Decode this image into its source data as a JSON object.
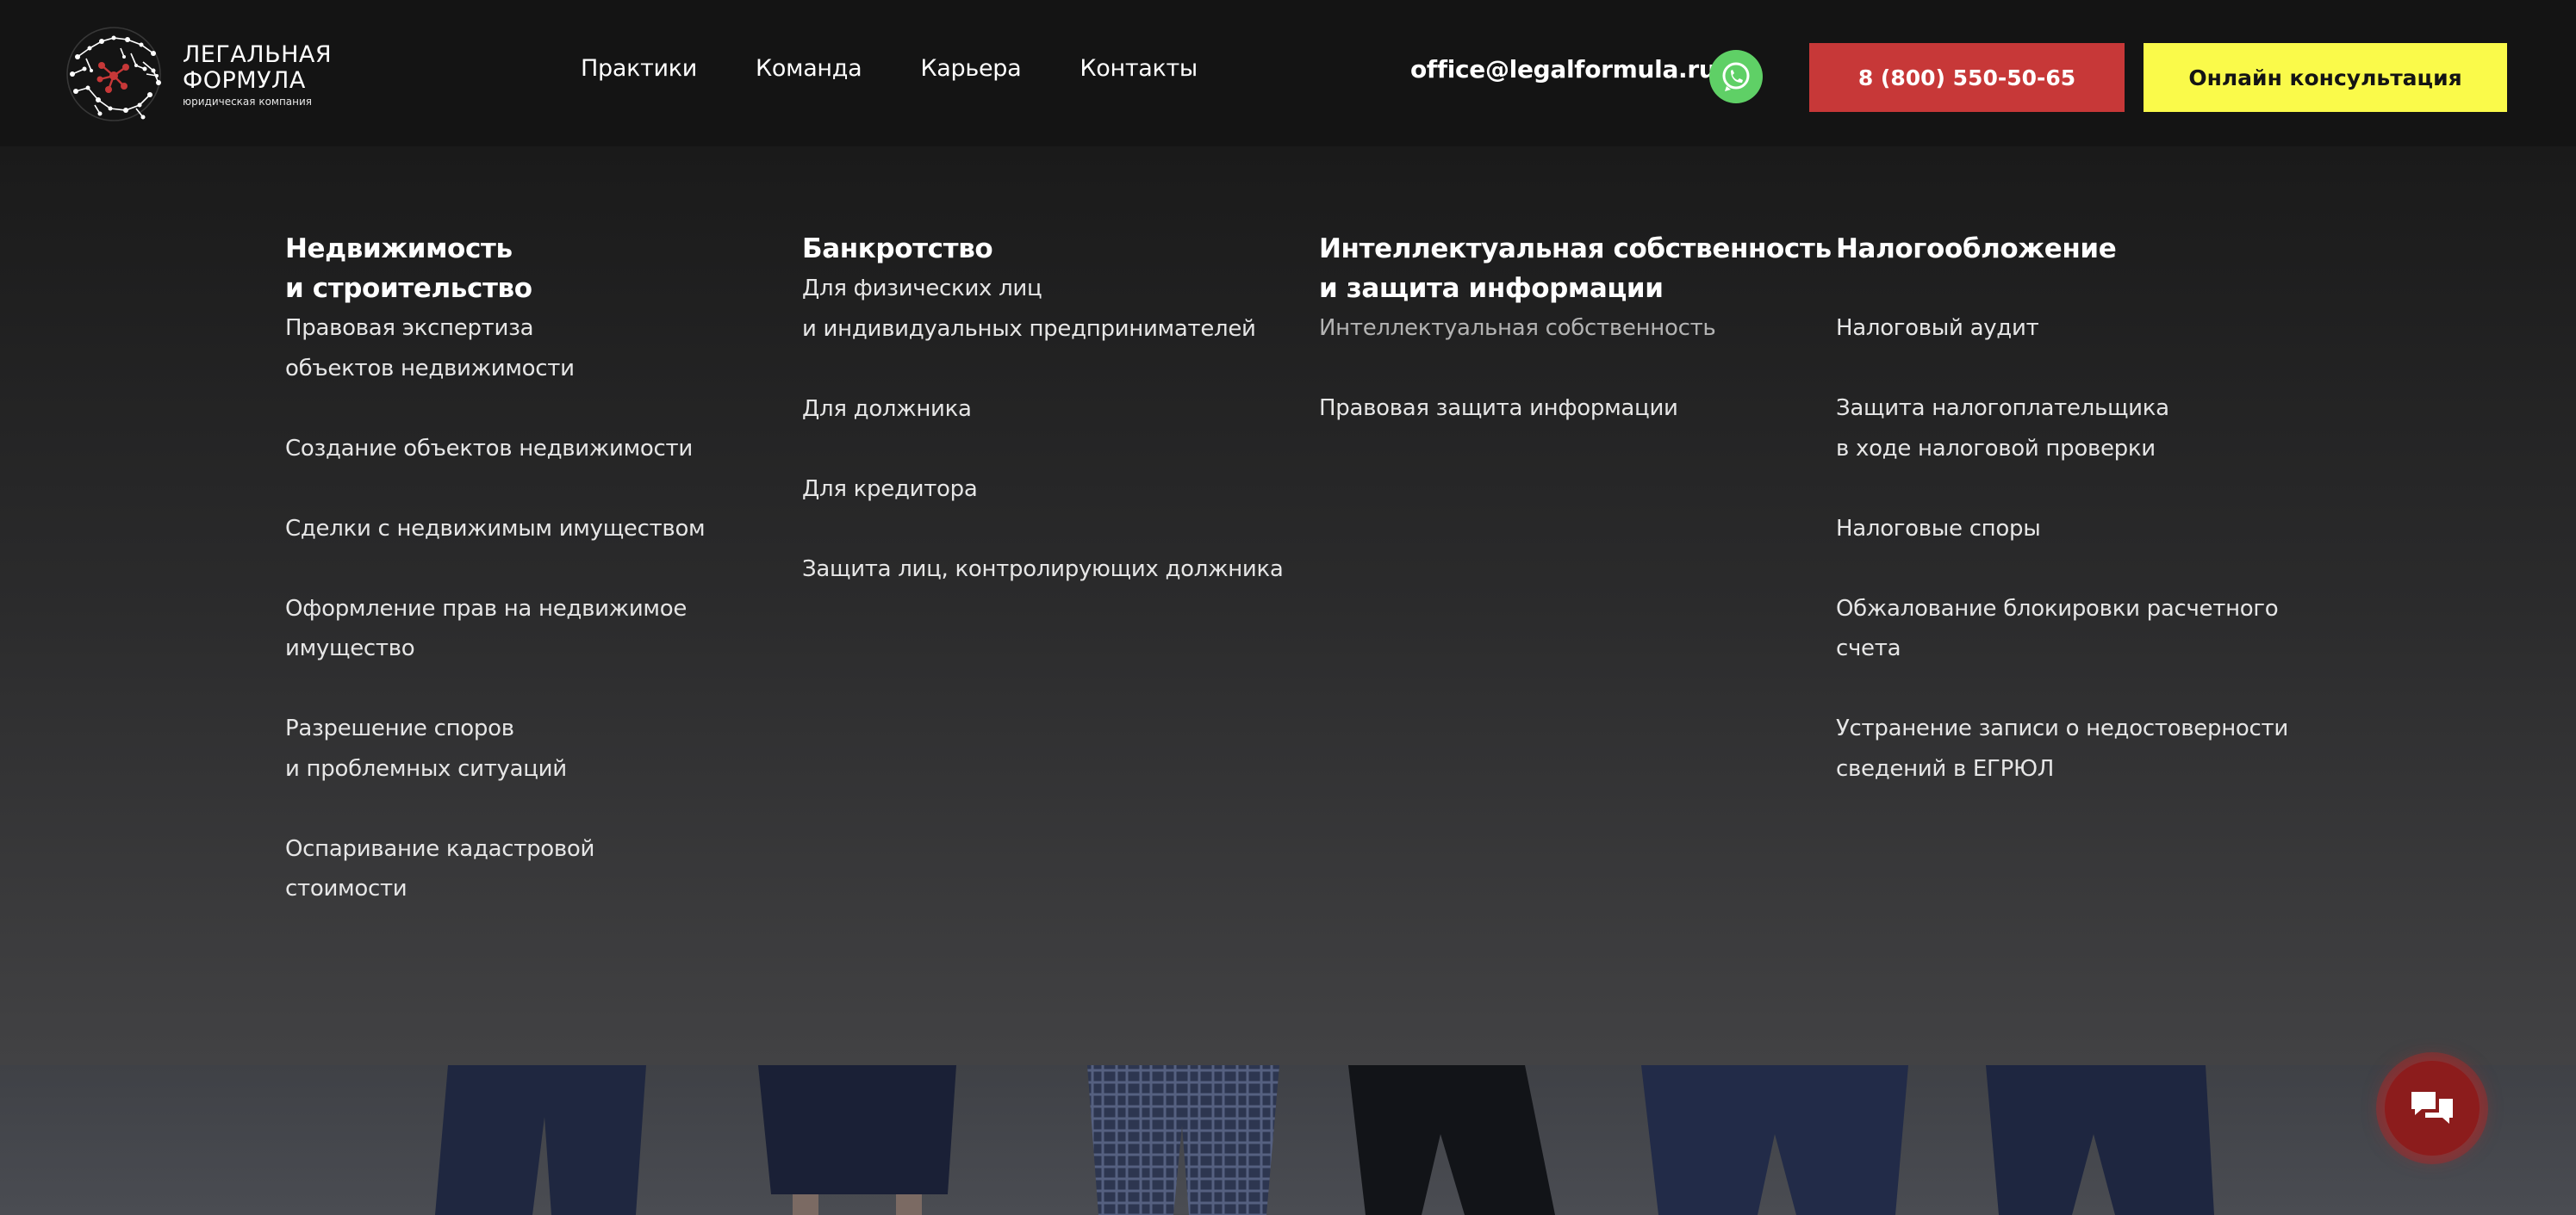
{
  "logo": {
    "line1": "ЛЕГАЛЬНАЯ",
    "line2": "ФОРМУЛА",
    "subtitle": "юридическая компания",
    "accent": "#c73838"
  },
  "nav": {
    "items": [
      "Практики",
      "Команда",
      "Карьера",
      "Контакты"
    ]
  },
  "contact": {
    "email": "office@legalformula.ru",
    "whatsapp_icon": "whatsapp-icon",
    "phone_label": "8 (800) 550-50-65",
    "consult_label": "Онлайн консультация"
  },
  "colors": {
    "phone_button": "#c73838",
    "consult_button": "#fafa4a",
    "whatsapp": "#5fd066",
    "chat_button": "#8c1c1c"
  },
  "menu": {
    "columns": [
      {
        "title": [
          "Недвижимость",
          "и строительство"
        ],
        "links": [
          [
            "Правовая экспертиза",
            "объектов недвижимости"
          ],
          [
            "Создание объектов недвижимости"
          ],
          [
            "Сделки с недвижимым имуществом"
          ],
          [
            "Оформление прав на недвижимое",
            "имущество"
          ],
          [
            "Разрешение споров",
            "и проблемных ситуаций"
          ],
          [
            "Оспаривание кадастровой",
            "стоимости"
          ]
        ]
      },
      {
        "title": [
          "Банкротство"
        ],
        "links": [
          [
            "Для физических лиц",
            "и индивидуальных предпринимателей"
          ],
          [
            "Для должника"
          ],
          [
            "Для кредитора"
          ],
          [
            "Защита лиц, контролирующих должника"
          ]
        ]
      },
      {
        "title": [
          "Интеллектуальная собственность",
          "и защита информации"
        ],
        "links": [
          [
            "Интеллектуальная собственность"
          ],
          [
            "Правовая защита информации"
          ]
        ]
      },
      {
        "title": [
          "Налогообложение"
        ],
        "links": [
          [
            "Налоговый аудит"
          ],
          [
            "Защита налогоплательщика",
            "в ходе налоговой проверки"
          ],
          [
            "Налоговые споры"
          ],
          [
            "Обжалование блокировки расчетного",
            "счета"
          ],
          [
            "Устранение записи о недостоверности",
            "сведений в ЕГРЮЛ"
          ]
        ]
      }
    ]
  },
  "chat": {
    "icon": "chat-icon"
  }
}
